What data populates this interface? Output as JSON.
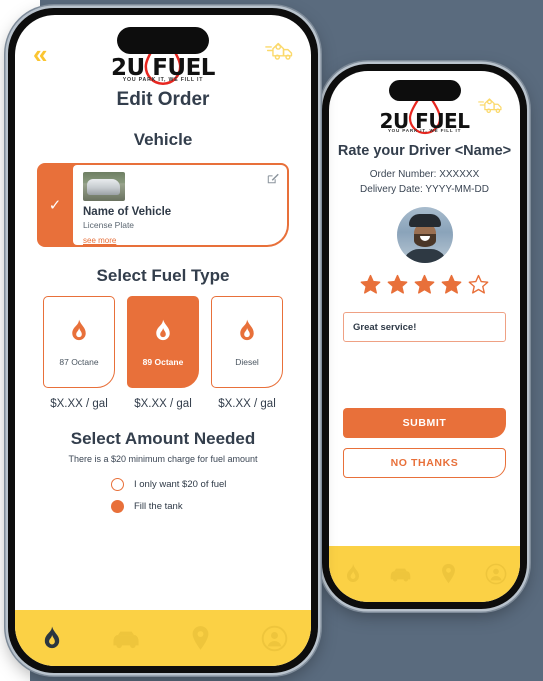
{
  "brand": {
    "logo_text": "2U FUEL",
    "logo_tagline": "YOU PARK IT, WE FILL IT",
    "accent_orange": "#e8703a",
    "accent_yellow": "#fbd145",
    "logo_red": "#e8261f",
    "text_dark": "#333e4c",
    "backdrop": "#5a6b7e"
  },
  "edit_order_screen": {
    "back_label": "«",
    "title": "Edit Order",
    "vehicle_section_title": "Vehicle",
    "vehicle": {
      "name": "Name of Vehicle",
      "license_plate": "License Plate",
      "see_more": "see more",
      "selected_mark": "✓"
    },
    "fuel_section_title": "Select Fuel Type",
    "fuel_types": [
      {
        "label": "87 Octane",
        "price": "$X.XX / gal",
        "selected": false
      },
      {
        "label": "89 Octane",
        "price": "$X.XX / gal",
        "selected": true
      },
      {
        "label": "Diesel",
        "price": "$X.XX / gal",
        "selected": false
      }
    ],
    "amount_section_title": "Select Amount Needed",
    "amount_note": "There is a $20 minimum charge for fuel amount",
    "amount_options": [
      {
        "label": "I only want $20 of fuel",
        "selected": false
      },
      {
        "label": "Fill the tank",
        "selected": true
      }
    ],
    "nav": [
      {
        "icon": "flame-icon",
        "active": true
      },
      {
        "icon": "car-icon",
        "active": false
      },
      {
        "icon": "location-pin-icon",
        "active": false
      },
      {
        "icon": "profile-icon",
        "active": false
      }
    ]
  },
  "rate_driver_screen": {
    "title": "Rate your Driver <Name>",
    "order_number": "Order Number: XXXXXX",
    "delivery_date": "Delivery Date: YYYY-MM-DD",
    "rating_filled": 4,
    "rating_total": 5,
    "comment_value": "Great service!",
    "submit_label": "SUBMIT",
    "no_thanks_label": "NO THANKS",
    "nav": [
      {
        "icon": "flame-icon",
        "active": true
      },
      {
        "icon": "car-icon",
        "active": false
      },
      {
        "icon": "location-pin-icon",
        "active": false
      },
      {
        "icon": "profile-icon",
        "active": false
      }
    ]
  }
}
